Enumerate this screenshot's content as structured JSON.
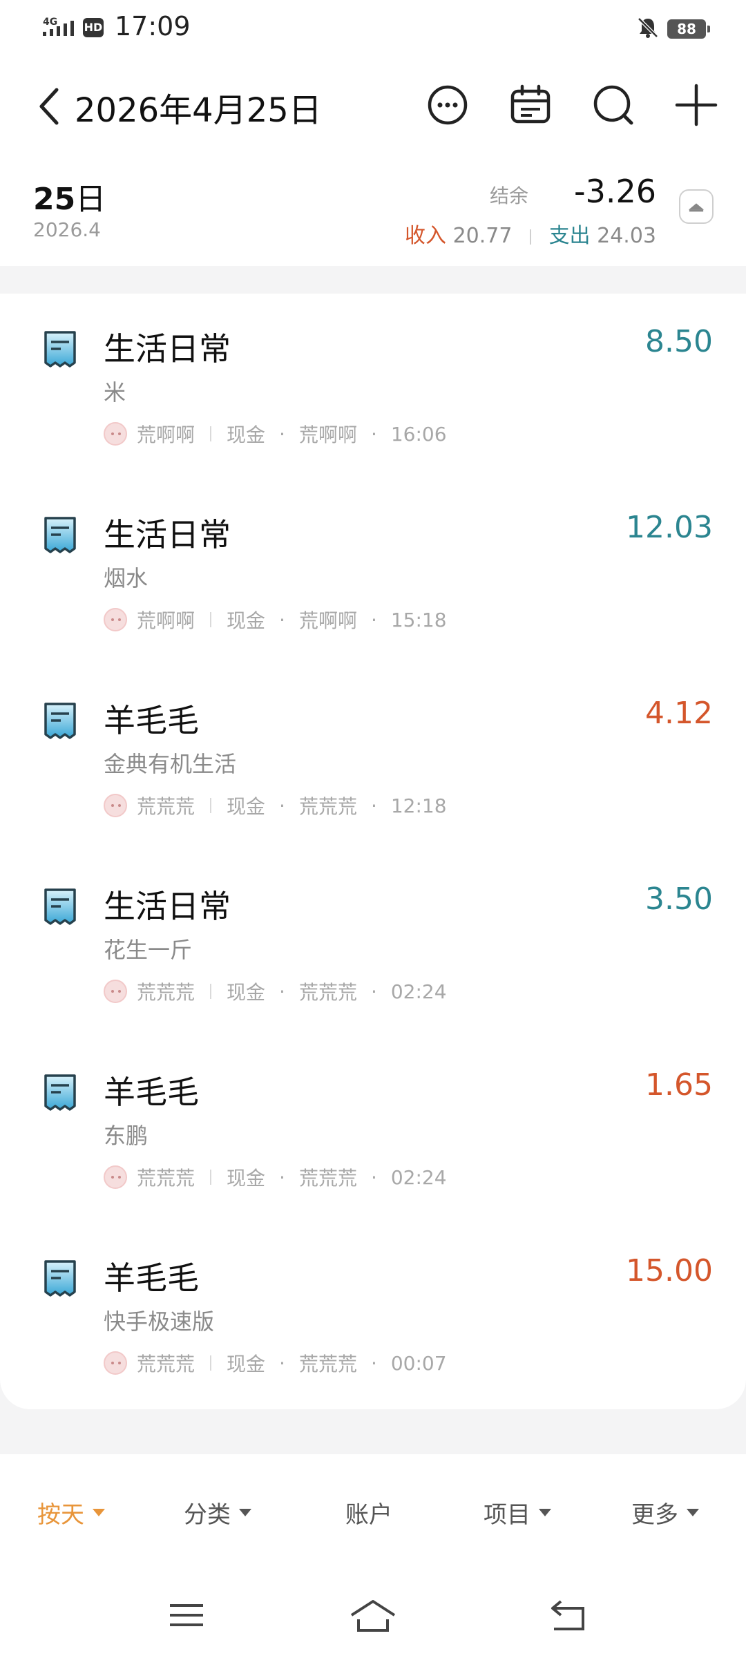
{
  "status_bar": {
    "network": "4G",
    "hd": "HD",
    "time": "17:09",
    "battery": "88",
    "icons": [
      "signal-icon",
      "hd-icon",
      "mute-bell-icon",
      "battery-icon"
    ]
  },
  "header": {
    "title": "2026年4月25日",
    "icons": [
      "back-icon",
      "more-icon",
      "calendar-icon",
      "search-icon",
      "add-icon"
    ]
  },
  "summary": {
    "day": "25",
    "day_suffix": "日",
    "month": "2026.4",
    "balance_label": "结余",
    "balance_value": "-3.26",
    "income_label": "收入",
    "income_value": "20.77",
    "expense_label": "支出",
    "expense_value": "24.03"
  },
  "records": [
    {
      "category": "生活日常",
      "note": "米",
      "member": "荒啊啊",
      "account": "现金",
      "creator": "荒啊啊",
      "time": "16:06",
      "amount": "8.50",
      "kind": "expense"
    },
    {
      "category": "生活日常",
      "note": "烟水",
      "member": "荒啊啊",
      "account": "现金",
      "creator": "荒啊啊",
      "time": "15:18",
      "amount": "12.03",
      "kind": "expense"
    },
    {
      "category": "羊毛毛",
      "note": "金典有机生活",
      "member": "荒荒荒",
      "account": "现金",
      "creator": "荒荒荒",
      "time": "12:18",
      "amount": "4.12",
      "kind": "income"
    },
    {
      "category": "生活日常",
      "note": "花生一斤",
      "member": "荒荒荒",
      "account": "现金",
      "creator": "荒荒荒",
      "time": "02:24",
      "amount": "3.50",
      "kind": "expense"
    },
    {
      "category": "羊毛毛",
      "note": "东鹏",
      "member": "荒荒荒",
      "account": "现金",
      "creator": "荒荒荒",
      "time": "02:24",
      "amount": "1.65",
      "kind": "income"
    },
    {
      "category": "羊毛毛",
      "note": "快手极速版",
      "member": "荒荒荒",
      "account": "现金",
      "creator": "荒荒荒",
      "time": "00:07",
      "amount": "15.00",
      "kind": "income"
    }
  ],
  "tabs": [
    {
      "label": "按天",
      "caret": true,
      "active": true
    },
    {
      "label": "分类",
      "caret": true,
      "active": false
    },
    {
      "label": "账户",
      "caret": false,
      "active": false
    },
    {
      "label": "项目",
      "caret": true,
      "active": false
    },
    {
      "label": "更多",
      "caret": true,
      "active": false
    }
  ],
  "colors": {
    "income": "#d4562b",
    "expense": "#2b8590",
    "active_tab": "#e8953a",
    "background": "#f4f4f5"
  },
  "system_nav": [
    "menu-icon",
    "home-icon",
    "back-nav-icon"
  ]
}
